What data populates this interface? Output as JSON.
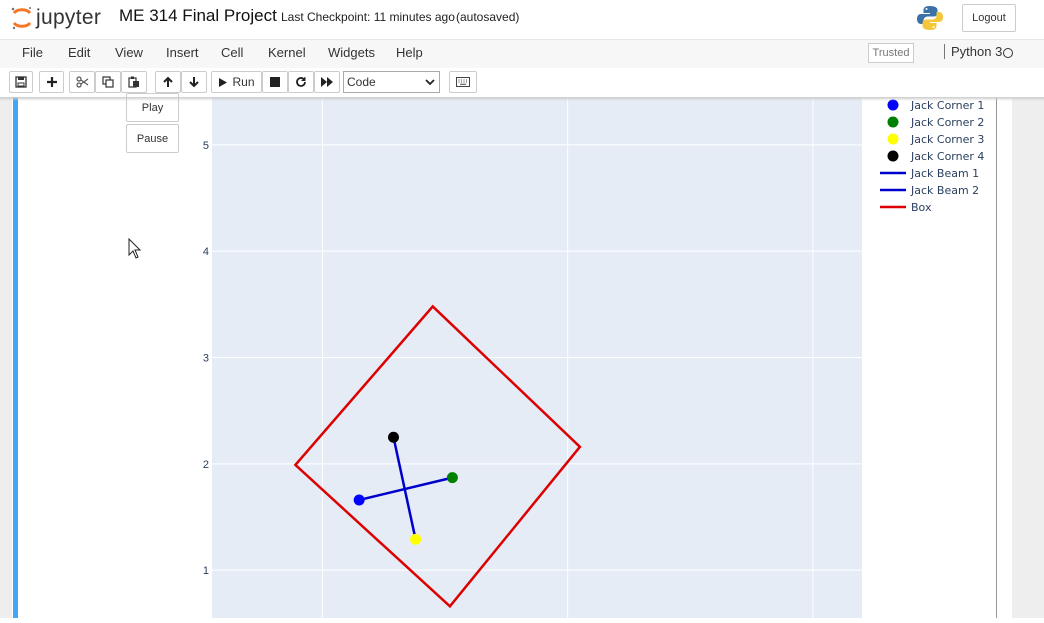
{
  "header": {
    "logo_text": "jupyter",
    "notebook_name": "ME 314 Final Project",
    "checkpoint": "Last Checkpoint: 11 minutes ago",
    "autosave": "(autosaved)",
    "logout_label": "Logout"
  },
  "menu": {
    "items": [
      "File",
      "Edit",
      "View",
      "Insert",
      "Cell",
      "Kernel",
      "Widgets",
      "Help"
    ],
    "trusted": "Trusted",
    "kernel_name": "Python 3"
  },
  "toolbar": {
    "run_label": "Run",
    "cell_type": "Code",
    "icons": [
      "save-icon",
      "plus-icon",
      "cut-icon",
      "copy-icon",
      "paste-icon",
      "arrow-up-icon",
      "arrow-down-icon",
      "run-icon",
      "stop-icon",
      "restart-icon",
      "fast-forward-icon",
      "keyboard-icon"
    ]
  },
  "widget": {
    "play_label": "Play",
    "pause_label": "Pause"
  },
  "colors": {
    "cell_bar": "#42a5f5",
    "plot_bg": "#e5ecf6",
    "box": "#dd0000",
    "beam": "#0000cc",
    "corner1": "#0000ff",
    "corner2": "#008000",
    "corner3": "#ffff00",
    "corner4": "#000000"
  },
  "chart_data": {
    "type": "scatter",
    "xlim": [
      -0.45,
      2.2
    ],
    "ylim": [
      0.55,
      5.45
    ],
    "yticks": [
      1,
      2,
      3,
      4,
      5
    ],
    "grid": true,
    "legend_position": "top-right",
    "legend": [
      {
        "name": "Jack Corner 1",
        "kind": "marker",
        "color": "#0000ff"
      },
      {
        "name": "Jack Corner 2",
        "kind": "marker",
        "color": "#008000"
      },
      {
        "name": "Jack Corner 3",
        "kind": "marker",
        "color": "#ffff00"
      },
      {
        "name": "Jack Corner 4",
        "kind": "marker",
        "color": "#000000"
      },
      {
        "name": "Jack Beam 1",
        "kind": "line",
        "color": "#0000cc"
      },
      {
        "name": "Jack Beam 2",
        "kind": "line",
        "color": "#0000cc"
      },
      {
        "name": "Box",
        "kind": "line",
        "color": "#dd0000"
      }
    ],
    "points": [
      {
        "series": "Jack Corner 1",
        "x": 0.15,
        "y": 1.66,
        "color": "#0000ff"
      },
      {
        "series": "Jack Corner 2",
        "x": 0.53,
        "y": 1.87,
        "color": "#008000"
      },
      {
        "series": "Jack Corner 3",
        "x": 0.38,
        "y": 1.29,
        "color": "#ffff00"
      },
      {
        "series": "Jack Corner 4",
        "x": 0.29,
        "y": 2.25,
        "color": "#000000"
      }
    ],
    "beams": [
      {
        "series": "Jack Beam 1",
        "from": [
          0.15,
          1.66
        ],
        "to": [
          0.53,
          1.87
        ]
      },
      {
        "series": "Jack Beam 2",
        "from": [
          0.29,
          2.25
        ],
        "to": [
          0.38,
          1.29
        ]
      }
    ],
    "box": [
      [
        0.45,
        3.48
      ],
      [
        1.05,
        2.16
      ],
      [
        0.52,
        0.66
      ],
      [
        -0.11,
        1.99
      ]
    ]
  }
}
